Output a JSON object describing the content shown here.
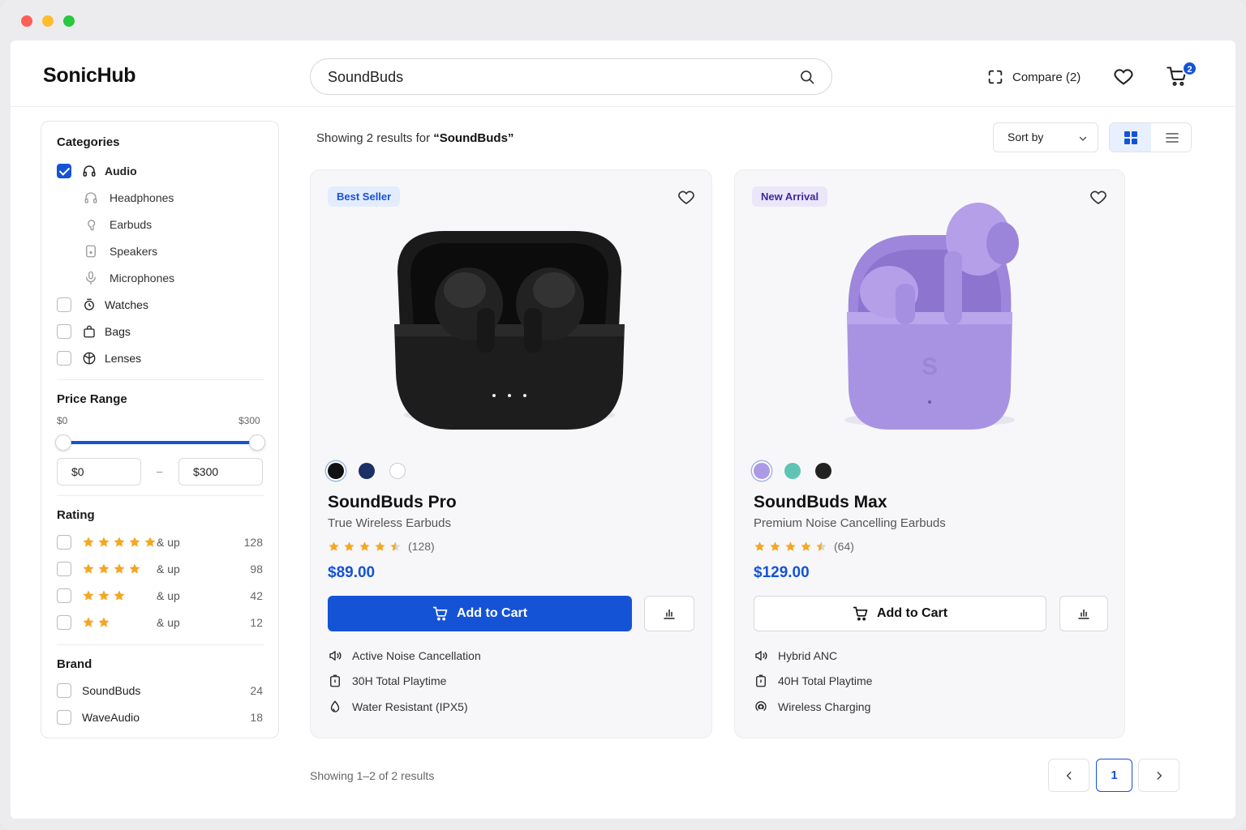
{
  "header": {
    "logo": "SonicHub",
    "search_value": "SoundBuds",
    "compare_label": "Compare (2)",
    "cart_count": "2"
  },
  "sidebar": {
    "categories_title": "Categories",
    "categories": [
      {
        "label": "Audio",
        "checked": true,
        "icon": "headphones-icon"
      },
      {
        "label": "Watches",
        "checked": false,
        "icon": "watch-icon"
      },
      {
        "label": "Bags",
        "checked": false,
        "icon": "bag-icon"
      },
      {
        "label": "Lenses",
        "checked": false,
        "icon": "lens-icon"
      }
    ],
    "subcategories": [
      {
        "label": "Headphones",
        "icon": "headphones-icon"
      },
      {
        "label": "Earbuds",
        "icon": "earbud-icon"
      },
      {
        "label": "Speakers",
        "icon": "speaker-icon"
      },
      {
        "label": "Microphones",
        "icon": "microphone-icon"
      }
    ],
    "price_title": "Price Range",
    "price_min_label": "$0",
    "price_max_label": "$300",
    "price_min_value": "$0",
    "price_max_value": "$300",
    "price_dash": "–",
    "rating_title": "Rating",
    "ratings": [
      {
        "stars": 5,
        "label": "& up",
        "count": "128"
      },
      {
        "stars": 4,
        "label": "& up",
        "count": "98"
      },
      {
        "stars": 3,
        "label": "& up",
        "count": "42"
      },
      {
        "stars": 2,
        "label": "& up",
        "count": "12"
      }
    ],
    "brand_title": "Brand",
    "brands": [
      {
        "label": "SoundBuds",
        "count": "24"
      },
      {
        "label": "WaveAudio",
        "count": "18"
      }
    ]
  },
  "main": {
    "results_prefix": "Showing 2 results for ",
    "results_query": "“SoundBuds”",
    "sort_label": "Sort by",
    "footer_text": "Showing 1–2 of 2 results",
    "current_page": "1"
  },
  "products": [
    {
      "tag": "Best Seller",
      "name": "SoundBuds Pro",
      "subtitle": "True Wireless Earbuds",
      "rating": 4.5,
      "reviews": "(128)",
      "price": "$89.00",
      "cart_label": "Add to Cart",
      "swatches": [
        "#111111",
        "#1c2f66",
        "#ffffff"
      ],
      "features": [
        {
          "icon": "noise-cancel-icon",
          "label": "Active Noise Cancellation"
        },
        {
          "icon": "battery-icon",
          "label": "30H Total Playtime"
        },
        {
          "icon": "water-drop-icon",
          "label": "Water Resistant (IPX5)"
        }
      ]
    },
    {
      "tag": "New Arrival",
      "name": "SoundBuds Max",
      "subtitle": "Premium Noise Cancelling Earbuds",
      "rating": 4.5,
      "reviews": "(64)",
      "price": "$129.00",
      "cart_label": "Add to Cart",
      "swatches": [
        "#ad9ae6",
        "#5fc4b4",
        "#222222"
      ],
      "features": [
        {
          "icon": "noise-cancel-icon",
          "label": "Hybrid ANC"
        },
        {
          "icon": "battery-icon",
          "label": "40H Total Playtime"
        },
        {
          "icon": "wireless-charging-icon",
          "label": "Wireless Charging"
        }
      ]
    }
  ],
  "colors": {
    "accent": "#1553d6",
    "star": "#f5a623",
    "tag_best_bg": "#e3ecfd",
    "tag_new_bg": "#ece6fb"
  }
}
